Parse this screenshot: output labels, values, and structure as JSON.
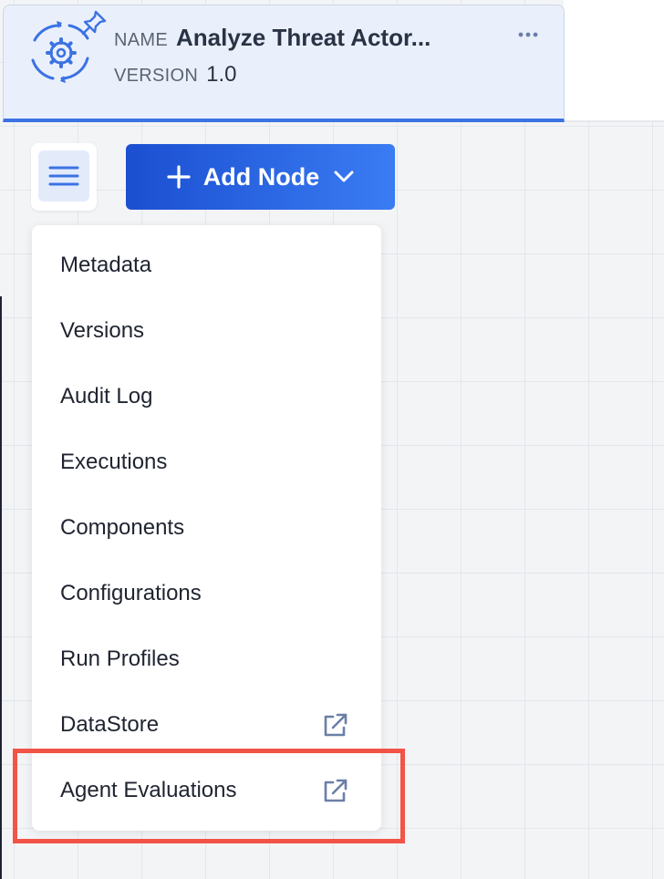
{
  "header": {
    "name_label": "NAME",
    "name_value": "Analyze Threat Actor...",
    "version_label": "VERSION",
    "version_value": "1.0",
    "icons": [
      "gear-cycle-icon",
      "pin-icon",
      "more-horizontal-icon"
    ]
  },
  "toolbar": {
    "menu_icon": "hamburger-icon",
    "add_node_label": "Add Node",
    "add_node_icons": [
      "plus-icon",
      "chevron-down-icon"
    ]
  },
  "menu": {
    "items": [
      {
        "label": "Metadata",
        "external": false
      },
      {
        "label": "Versions",
        "external": false
      },
      {
        "label": "Audit Log",
        "external": false
      },
      {
        "label": "Executions",
        "external": false
      },
      {
        "label": "Components",
        "external": false
      },
      {
        "label": "Configurations",
        "external": false
      },
      {
        "label": "Run Profiles",
        "external": false
      },
      {
        "label": "DataStore",
        "external": true
      },
      {
        "label": "Agent Evaluations",
        "external": true
      }
    ],
    "highlighted_item": "Agent Evaluations",
    "external_icon": "external-link-icon"
  },
  "colors": {
    "accent": "#3b72e4",
    "button_start": "#1b4fd1",
    "button_end": "#3a7cf3",
    "highlight": "#f15446",
    "header_bg": "#eaf0fb"
  }
}
